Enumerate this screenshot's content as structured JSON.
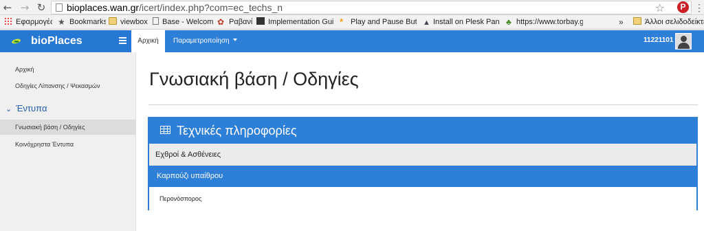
{
  "browser": {
    "url_host": "bioplaces.wan.gr",
    "url_path": "/icert/index.php?com=ec_techs_n",
    "bookmarks": [
      {
        "label": "Εφαρμογές",
        "icon": "apps-grid-icon"
      },
      {
        "label": "Bookmarks",
        "icon": "star-icon"
      },
      {
        "label": "viewbox",
        "icon": "folder-icon"
      },
      {
        "label": "Base - Welcome",
        "icon": "page-icon"
      },
      {
        "label": "Ραβανί",
        "icon": "leaf-icon"
      },
      {
        "label": "Implementation Guide",
        "icon": "square-icon"
      },
      {
        "label": "Play and Pause Button",
        "icon": "asterisk-icon"
      },
      {
        "label": "Install on Plesk Panel",
        "icon": "plesk-icon"
      },
      {
        "label": "https://www.torbay.gc",
        "icon": "plant-icon"
      },
      {
        "label": "Άλλοι σελιδοδείκτε",
        "icon": "folder-icon"
      }
    ],
    "more_label": "»"
  },
  "app": {
    "brand": "bioPlaces",
    "nav": {
      "home_tab": "Αρχική",
      "settings_tab": "Παραμετροποίηση"
    },
    "user_code": "11221101"
  },
  "sidebar": {
    "links": [
      {
        "label": "Αρχική"
      },
      {
        "label": "Οδηγίες Λίπανσης / Ψεκασμών"
      }
    ],
    "section": {
      "label": "Έντυπα",
      "items": [
        {
          "label": "Γνωσιακή βάση / Οδηγίες",
          "active": true
        },
        {
          "label": "Κοινόχρηστα Έντυπα",
          "active": false
        }
      ]
    }
  },
  "main": {
    "page_title": "Γνωσιακή βάση / Οδηγίες",
    "panel": {
      "title": "Τεχνικές πληροφορίες",
      "group": "Εχθροί & Ασθένειες",
      "item": "Καρπούζι υπαίθρου",
      "sub_item": "Περονόσπορος"
    }
  },
  "colors": {
    "primary": "#2e7fd7",
    "sidebar_bg": "#f0f0f0",
    "active_side": "#dcdcdc"
  }
}
